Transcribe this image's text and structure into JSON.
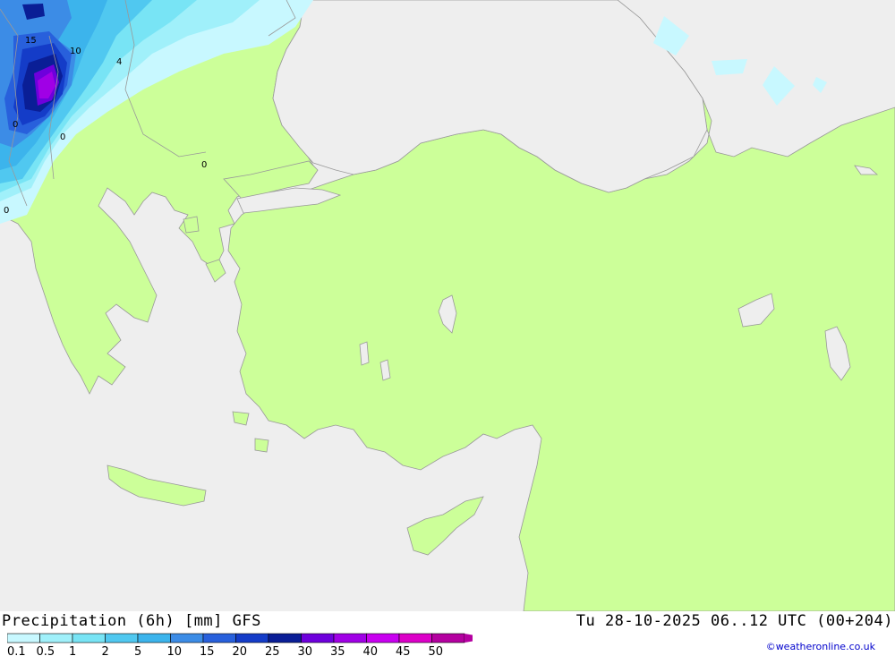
{
  "map": {
    "sea_color": "#eeeeee",
    "land_color": "#ccff99",
    "border_color": "#999999",
    "contour_labels": [
      "15",
      "10",
      "4",
      "0",
      "0",
      "0",
      "0"
    ]
  },
  "footer": {
    "title": "Precipitation (6h) [mm] GFS",
    "datetime": "Tu 28-10-2025 06..12 UTC (00+204)",
    "credit": "©weatheronline.co.uk"
  },
  "legend": {
    "labels": [
      "0.1",
      "0.5",
      "1",
      "2",
      "5",
      "10",
      "15",
      "20",
      "25",
      "30",
      "35",
      "40",
      "45",
      "50"
    ],
    "colors": [
      "#c8f8ff",
      "#a0f0fa",
      "#78e4f5",
      "#50c8f0",
      "#3cb4ec",
      "#3c8ce6",
      "#2860dc",
      "#143cc8",
      "#0a1e96",
      "#6e00dc",
      "#a000e6",
      "#c800f0",
      "#dc00c8",
      "#b400a0"
    ]
  }
}
